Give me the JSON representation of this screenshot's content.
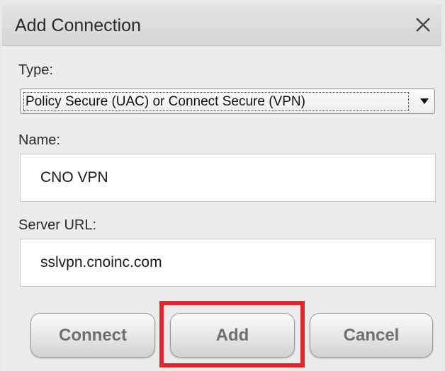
{
  "dialog": {
    "title": "Add Connection"
  },
  "form": {
    "type_label": "Type:",
    "type_value": "Policy Secure (UAC) or Connect Secure (VPN)",
    "name_label": "Name:",
    "name_value": "CNO VPN",
    "server_label": "Server URL:",
    "server_value": "sslvpn.cnoinc.com"
  },
  "buttons": {
    "connect": "Connect",
    "add": "Add",
    "cancel": "Cancel"
  },
  "icons": {
    "close": "close-icon",
    "dropdown": "chevron-down-icon"
  },
  "colors": {
    "highlight": "#e3262c"
  }
}
